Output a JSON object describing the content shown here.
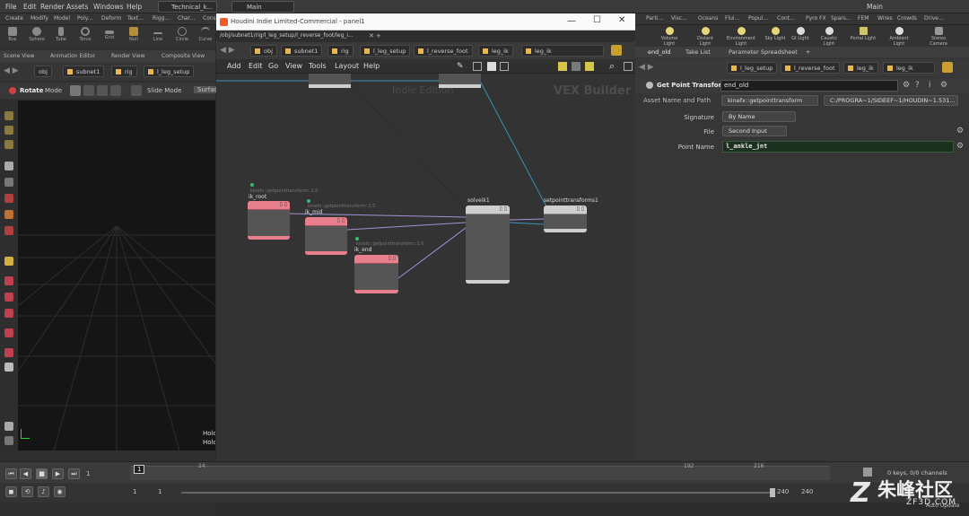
{
  "main_menu": [
    "File",
    "Edit",
    "Render",
    "Assets",
    "Windows",
    "Help"
  ],
  "desktop_tabs": {
    "technical": "Technical_k...",
    "main": "Main"
  },
  "right_title_main": "Main",
  "shelf_tabs": [
    "Create",
    "Modify",
    "Model",
    "Poly...",
    "Deform",
    "Text...",
    "Rigg...",
    "Char...",
    "Cons..."
  ],
  "shelf_tools": [
    "Box",
    "Sphere",
    "Tube",
    "Torus",
    "Grid",
    "Null",
    "Line",
    "Circle",
    "Curve"
  ],
  "right_shelf_tabs": [
    "Parti...",
    "Visc...",
    "Oceans",
    "Flui...",
    "Popul...",
    "Cont...",
    "Pyro FX",
    "Spars...",
    "FEM",
    "Wires",
    "Crowds",
    "Drive..."
  ],
  "right_shelf_tools": [
    "Volume Light",
    "Distant Light",
    "Environment Light",
    "Sky Light",
    "GI Light",
    "Caustic Light",
    "Portal Light",
    "Ambient Light",
    "Stereo Camera"
  ],
  "left_pane_tabs": [
    "Scene View",
    "Animation Editor",
    "Render View",
    "Composite View"
  ],
  "viewport_path": [
    "obj",
    "subnet1",
    "rig",
    "l_leg_setup"
  ],
  "viewport_toolbar": {
    "tool": "Rotate",
    "mode": "Mode",
    "slide": "Slide Mode",
    "surface": "Surface"
  },
  "viewport_hints": [
    "Hold",
    "Hold"
  ],
  "float_window": {
    "title": "Houdini Indie Limited-Commercial - panel1",
    "path": "/obj/subnet1/rig/l_leg_setup/l_reverse_foot/leg_i...",
    "breadcrumbs": [
      "obj",
      "subnet1",
      "rig",
      "l_leg_setup",
      "l_reverse_foot",
      "leg_ik",
      "leg_ik"
    ],
    "menu": [
      "Add",
      "Edit",
      "Go",
      "View",
      "Tools",
      "Layout",
      "Help"
    ],
    "watermark_indie": "Indie Edition",
    "watermark_vex": "VEX Builder",
    "nodes": {
      "ik_root": {
        "comment": "kinefx::getpointtransform::1.0",
        "name": "ik_root"
      },
      "ik_mid": {
        "comment": "kinefx::getpointtransform::1.0",
        "name": "ik_mid"
      },
      "ik_end": {
        "comment": "kinefx::getpointtransform::1.0",
        "name": "ik_end"
      },
      "solveik": {
        "name": "solveik1"
      },
      "setpoint": {
        "name": "setpointtransforms1"
      }
    }
  },
  "param_pane": {
    "tabs": [
      "end_old",
      "Take List",
      "Parameter Spreadsheet"
    ],
    "breadcrumbs": [
      "l_leg_setup",
      "l_reverse_foot",
      "leg_ik",
      "leg_ik"
    ],
    "node_type": "Get Point Transform",
    "node_name": "end_old",
    "asset_label": "Asset Name and Path",
    "asset_name": "kinefx::getpointtransform",
    "asset_path": "C:/PROGRA~1/SIDEEF~1/HOUDIN~1.531...",
    "params": [
      {
        "label": "Signature",
        "value": "By Name"
      },
      {
        "label": "File",
        "value": "Second Input"
      },
      {
        "label": "Point Name",
        "value": "l_ankle_jnt"
      }
    ]
  },
  "timeline": {
    "frame": "1",
    "start": "1",
    "end": "1",
    "range_end_a": "240",
    "range_end_b": "240",
    "tick_192": "192",
    "tick_216": "216",
    "tick_24": "24",
    "keys": "0 keys, 0/0 channels",
    "auto_update": "Auto Update"
  },
  "watermark": {
    "cn": "朱峰社区",
    "url": "ZF3D.COM"
  }
}
